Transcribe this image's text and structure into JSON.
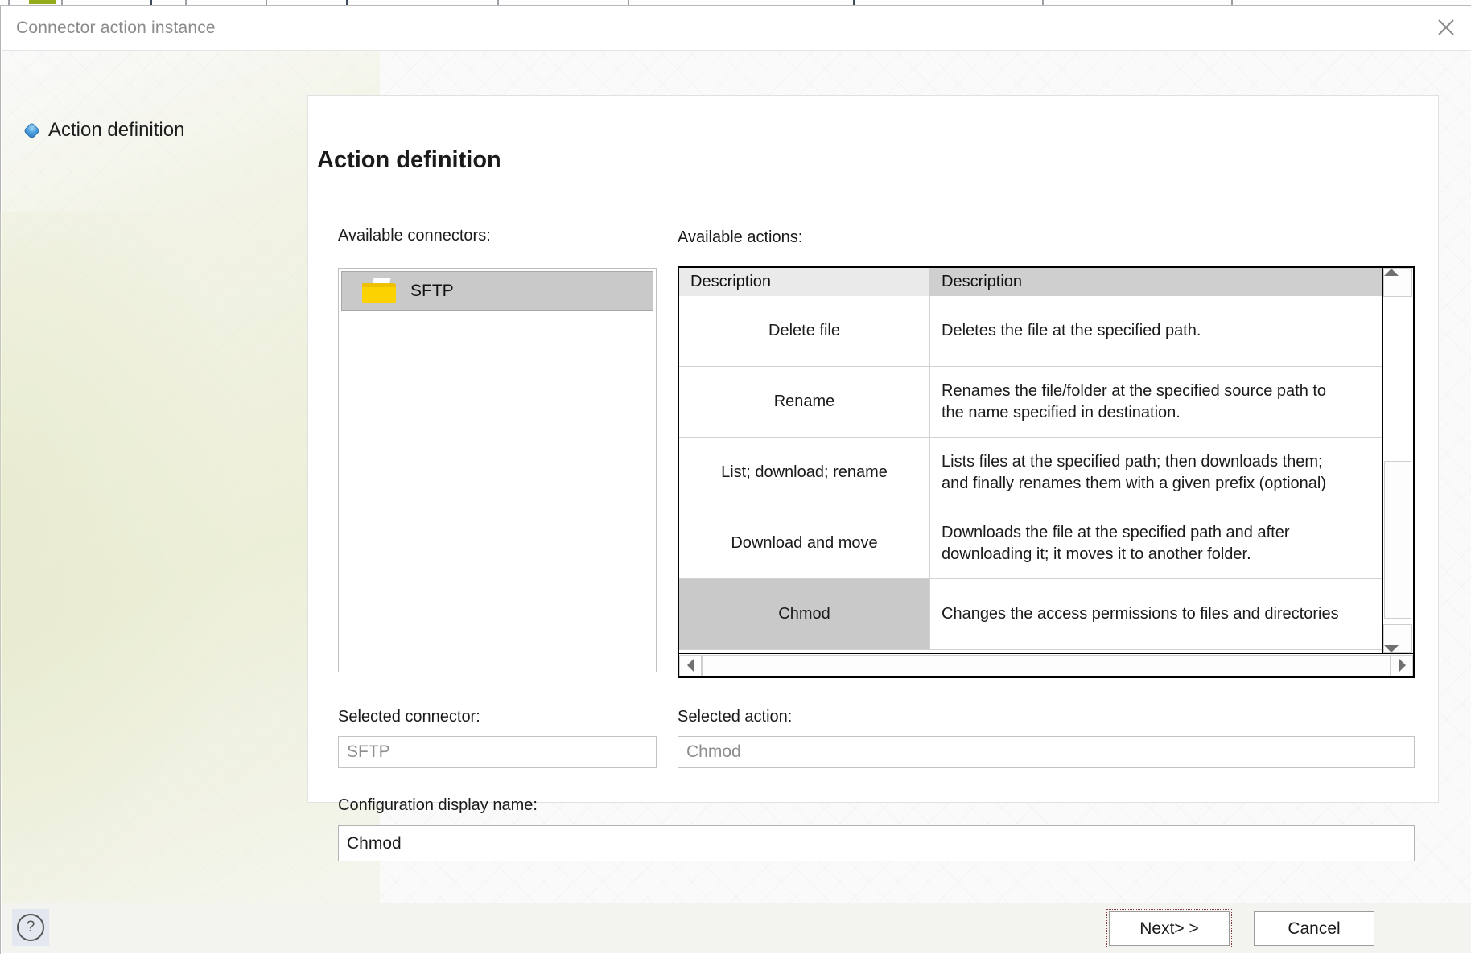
{
  "window": {
    "title": "Connector action instance",
    "close_icon": "close-icon"
  },
  "sidebar": {
    "items": [
      {
        "label": "Action definition",
        "icon": "blue-diamond-bullet-icon",
        "selected": true
      }
    ]
  },
  "main": {
    "heading": "Action definition",
    "connectors": {
      "label": "Available connectors:",
      "items": [
        {
          "name": "SFTP",
          "icon": "folder-icon",
          "selected": true
        }
      ]
    },
    "actions": {
      "label": "Available actions:",
      "columns": [
        "Description",
        "Description"
      ],
      "rows": [
        {
          "name": "Delete file",
          "description": "Deletes the file at the specified path.",
          "selected": false
        },
        {
          "name": "Rename",
          "description": "Renames the file/folder at the specified source path to\nthe name specified in destination.",
          "selected": false
        },
        {
          "name": "List; download; rename",
          "description": "Lists files at the specified path; then downloads them;\nand finally renames them with a given prefix (optional)",
          "selected": false
        },
        {
          "name": "Download and move",
          "description": "Downloads the file at the specified path and after\ndownloading it; it moves it to another folder.",
          "selected": false
        },
        {
          "name": "Chmod",
          "description": "Changes the access permissions to files and directories",
          "selected": true
        }
      ],
      "scroll_up_icon": "scroll-up-arrow-icon",
      "scroll_down_icon": "scroll-down-arrow-icon",
      "scroll_left_icon": "scroll-left-arrow-icon",
      "scroll_right_icon": "scroll-right-arrow-icon"
    },
    "selected_connector": {
      "label": "Selected connector:",
      "value": "SFTP"
    },
    "selected_action": {
      "label": "Selected action:",
      "value": "Chmod"
    },
    "configuration_display_name": {
      "label": "Configuration display name:",
      "value": "Chmod"
    }
  },
  "footer": {
    "help_icon": "help-question-icon",
    "help_glyph": "?",
    "next_label": "Next> >",
    "cancel_label": "Cancel"
  },
  "colors": {
    "selection_gray": "#c9c9c9",
    "header_gray": "#cfcfcf",
    "folder_yellow": "#fcd200",
    "accent_olive": "#92ac1b",
    "bullet_blue": "#4a9fe0"
  }
}
